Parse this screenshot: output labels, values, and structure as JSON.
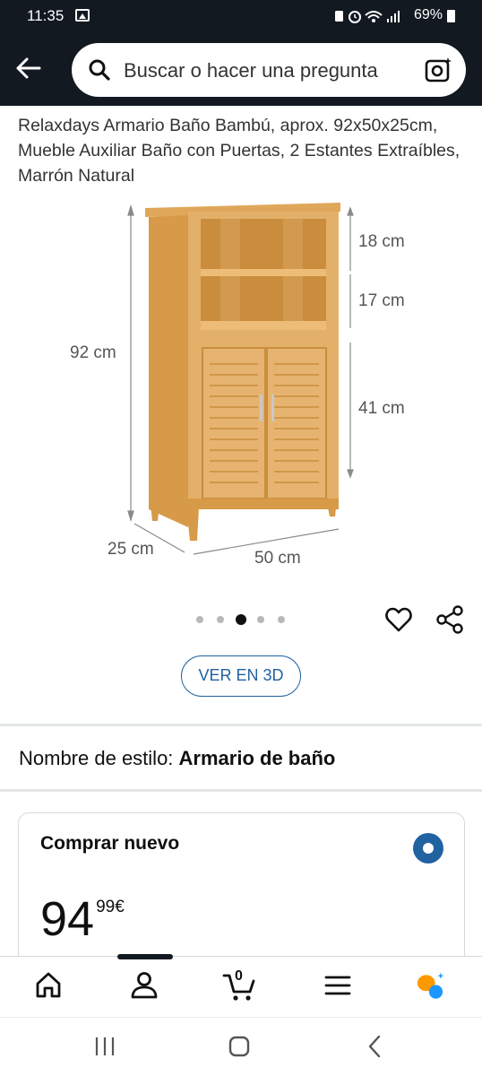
{
  "status_bar": {
    "time": "11:35",
    "battery": "69%",
    "icons": [
      "gallery-icon",
      "battery-saver-icon",
      "alarm-icon",
      "wifi-icon",
      "signal-icon"
    ]
  },
  "header": {
    "back_icon": "arrow-left-icon",
    "search_placeholder": "Buscar o hacer una pregunta",
    "camera_icon": "camera-scan-icon",
    "background": "#131921"
  },
  "product": {
    "title": "Relaxdays Armario Baño Bambú, aprox. 92x50x25cm, Mueble Auxiliar Baño con Puertas, 2 Estantes Extraíbles, Marrón Natural",
    "image_labels": {
      "height_total": "92 cm",
      "shelf_top": "18 cm",
      "shelf_mid": "17 cm",
      "cabinet": "41 cm",
      "depth": "25 cm",
      "width": "50 cm"
    },
    "carousel": {
      "count": 5,
      "active_index": 2
    },
    "view_3d": "VER EN 3D"
  },
  "style": {
    "label": "Nombre de estilo:",
    "value": "Armario de baño"
  },
  "buy_box": {
    "label": "Comprar nuevo",
    "price_whole": "94",
    "price_fraction": "99",
    "currency": "€",
    "selected": true
  },
  "bottom_nav": {
    "items": [
      "home-icon",
      "account-icon",
      "cart-icon",
      "menu-icon",
      "rufus-icon"
    ],
    "cart_count": "0",
    "active": "account-icon"
  },
  "colors": {
    "accent_blue": "#2162a1",
    "rufus_orange": "#ff9900",
    "rufus_blue": "#1a98ff"
  }
}
